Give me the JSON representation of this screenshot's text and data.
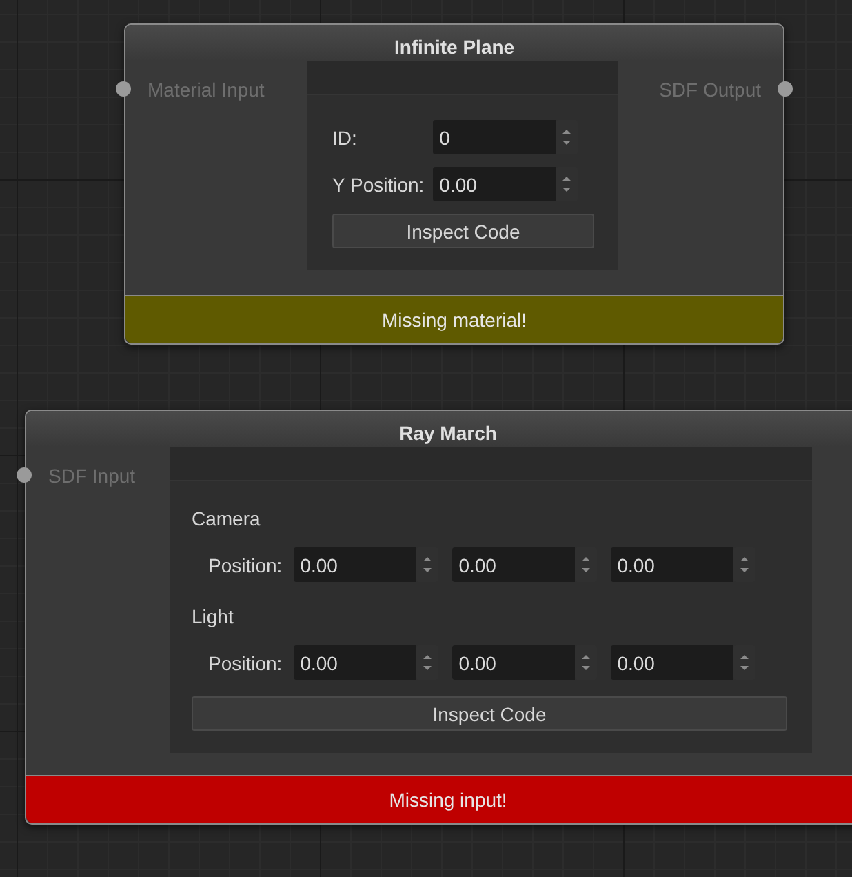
{
  "nodes": [
    {
      "title": "Infinite Plane",
      "inputs": [
        "Material Input"
      ],
      "outputs": [
        "SDF Output"
      ],
      "rows": [
        {
          "kind": "field",
          "label": "ID:",
          "values": [
            "0"
          ]
        },
        {
          "kind": "field",
          "label": "Y Position:",
          "values": [
            "0.00"
          ]
        }
      ],
      "button": "Inspect Code",
      "status": {
        "text": "Missing material!",
        "color": "#5f5a00"
      }
    },
    {
      "title": "Ray March",
      "inputs": [
        "SDF Input"
      ],
      "rows": [
        {
          "kind": "heading",
          "label": "Camera"
        },
        {
          "kind": "field",
          "label": "Position:",
          "values": [
            "0.00",
            "0.00",
            "0.00"
          ]
        },
        {
          "kind": "heading",
          "label": "Light"
        },
        {
          "kind": "field",
          "label": "Position:",
          "values": [
            "0.00",
            "0.00",
            "0.00"
          ]
        }
      ],
      "button": "Inspect Code",
      "status": {
        "text": "Missing input!",
        "color": "#bf0000"
      }
    }
  ]
}
